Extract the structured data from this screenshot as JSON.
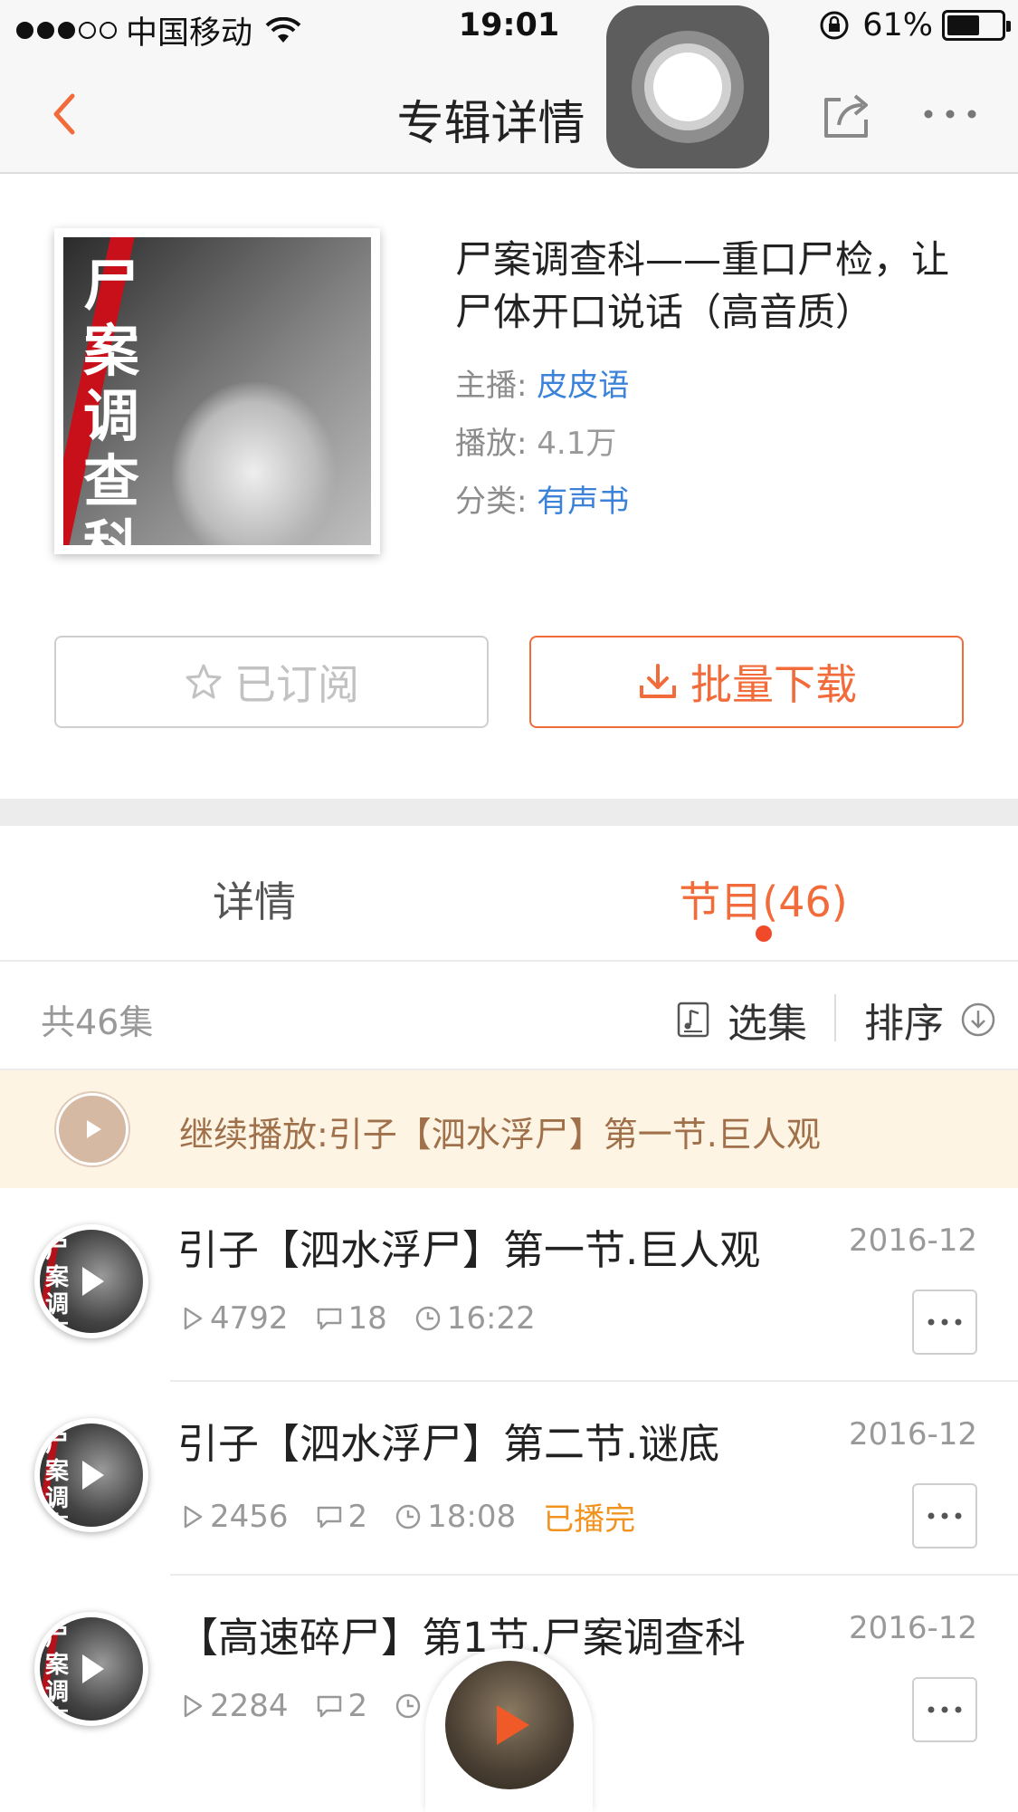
{
  "status_bar": {
    "carrier": "中国移动",
    "time": "19:01",
    "battery_percent": "61%",
    "battery_level": 0.61
  },
  "nav": {
    "title": "专辑详情"
  },
  "album": {
    "title": "尸案调查科——重口尸检，让尸体开口说话（高音质）",
    "cover_text": "尸案调查科",
    "host_label": "主播:",
    "host": "皮皮语",
    "plays_label": "播放:",
    "plays": "4.1万",
    "category_label": "分类:",
    "category": "有声书"
  },
  "actions": {
    "subscribe_label": "已订阅",
    "download_label": "批量下载"
  },
  "tabs": {
    "details": "详情",
    "programs": "节目(46)"
  },
  "list_header": {
    "count": "共46集",
    "select": "选集",
    "sort": "排序"
  },
  "resume": {
    "text": "继续播放:引子【泗水浮尸】第一节.巨人观"
  },
  "episodes": [
    {
      "title": "引子【泗水浮尸】第一节.巨人观",
      "date": "2016-12",
      "plays": "4792",
      "comments": "18",
      "duration": "16:22",
      "status": ""
    },
    {
      "title": "引子【泗水浮尸】第二节.谜底",
      "date": "2016-12",
      "plays": "2456",
      "comments": "2",
      "duration": "18:08",
      "status": "已播完"
    },
    {
      "title": "【高速碎尸】第1节.尸案调查科",
      "date": "2016-12",
      "plays": "2284",
      "comments": "2",
      "duration": "",
      "status": ""
    }
  ],
  "colors": {
    "accent": "#f26b3a",
    "link": "#3b82d8",
    "done": "#f0941f",
    "resume_bg": "#fdf4e3"
  },
  "icons": [
    "back-icon",
    "share-icon",
    "more-icon",
    "star-icon",
    "download-icon",
    "playlist-icon",
    "sort-icon",
    "play-icon",
    "comment-icon",
    "clock-icon"
  ]
}
